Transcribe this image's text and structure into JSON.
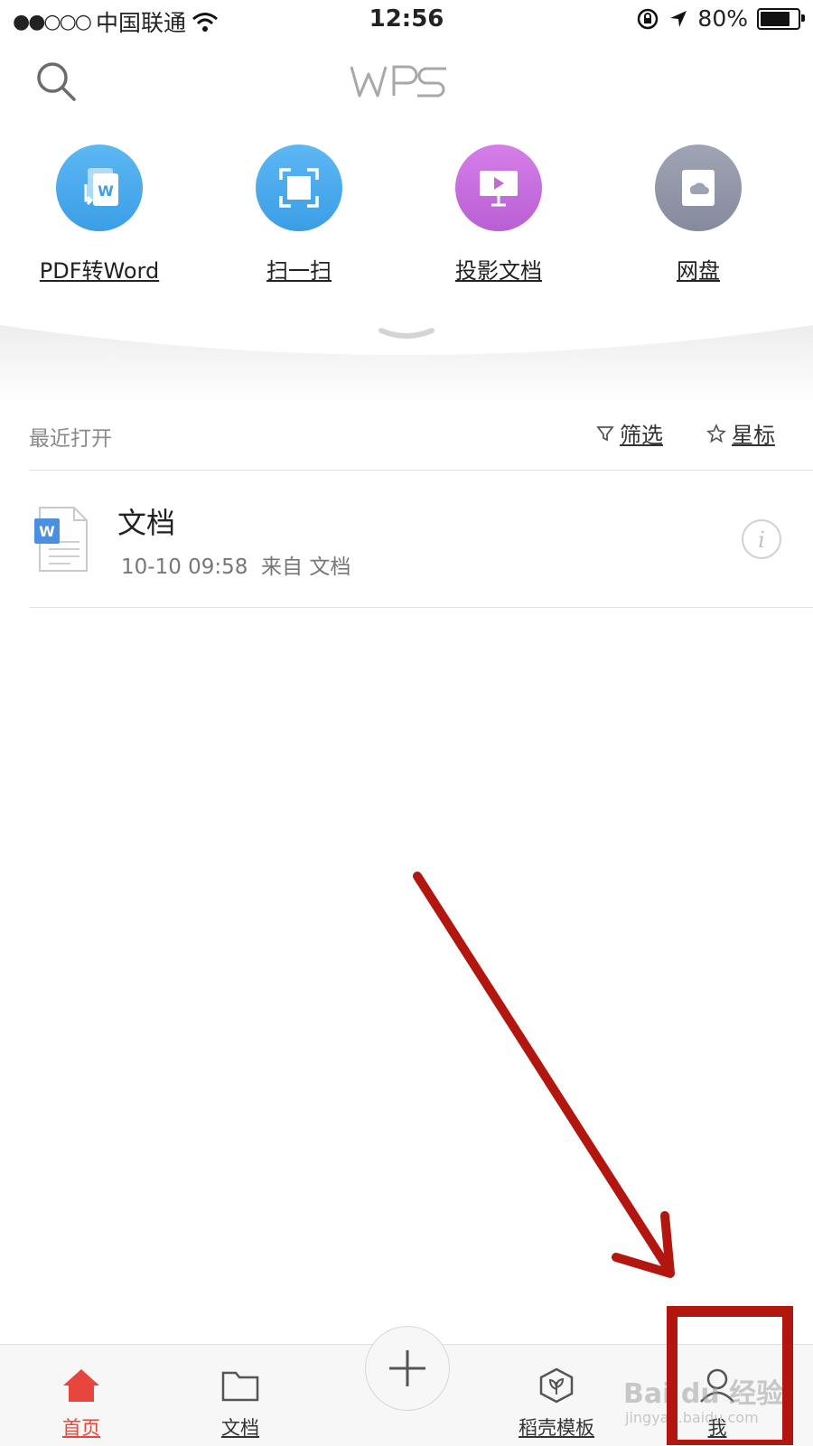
{
  "status_bar": {
    "signal": "●●○○○",
    "carrier": "中国联通",
    "time": "12:56",
    "battery": "80%"
  },
  "header": {
    "logo": "WPS"
  },
  "quick_actions": [
    {
      "label": "PDF转Word",
      "icon": "pdf-to-word-icon",
      "color": "#4aa9ee"
    },
    {
      "label": "扫一扫",
      "icon": "scan-icon",
      "color": "#4aa9ee"
    },
    {
      "label": "投影文档",
      "icon": "projection-icon",
      "color": "#c06ad8"
    },
    {
      "label": "网盘",
      "icon": "cloud-drive-icon",
      "color": "#8e93a5"
    }
  ],
  "recent": {
    "title": "最近打开",
    "filter_label": "筛选",
    "star_label": "星标",
    "files": [
      {
        "name": "文档",
        "meta": "10-10 09:58  来自 文档"
      }
    ]
  },
  "tabbar": {
    "home": "首页",
    "docs": "文档",
    "templates": "稻壳模板",
    "me": "我",
    "accent": "#e8453c"
  },
  "watermark": {
    "text": "Bai du 经验",
    "url": "jingyan.baidu.com"
  },
  "annotation_color": "#b3160f"
}
